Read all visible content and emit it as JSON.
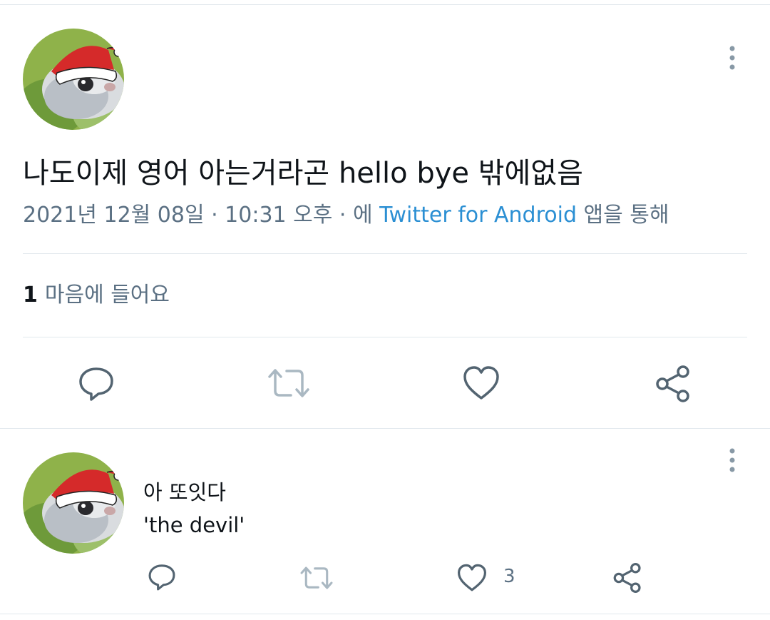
{
  "main_tweet": {
    "avatar": "squirrel-avatar-with-santa-hat",
    "text": "나도이제 영어 아는거라곤 hello bye 밖에없음",
    "timestamp": "2021년 12월 08일 · 10:31 오후 · 에",
    "source": "Twitter for Android",
    "source_suffix": "앱을 통해",
    "likes_count": "1",
    "likes_label": "마음에 들어요",
    "actions": [
      "reply-icon",
      "retweet-icon",
      "like-icon",
      "share-icon"
    ]
  },
  "reply_tweet": {
    "avatar": "squirrel-avatar-with-santa-hat",
    "line1": "아 또잇다",
    "line2": "'the devil'",
    "like_count": "3",
    "actions": [
      "reply-icon",
      "retweet-icon",
      "like-icon",
      "share-icon"
    ]
  },
  "colors": {
    "text": "#0f1419",
    "secondary": "#5b7083",
    "link": "#2b8fd3",
    "divider": "#e1e8ed",
    "icon": "#536471"
  }
}
